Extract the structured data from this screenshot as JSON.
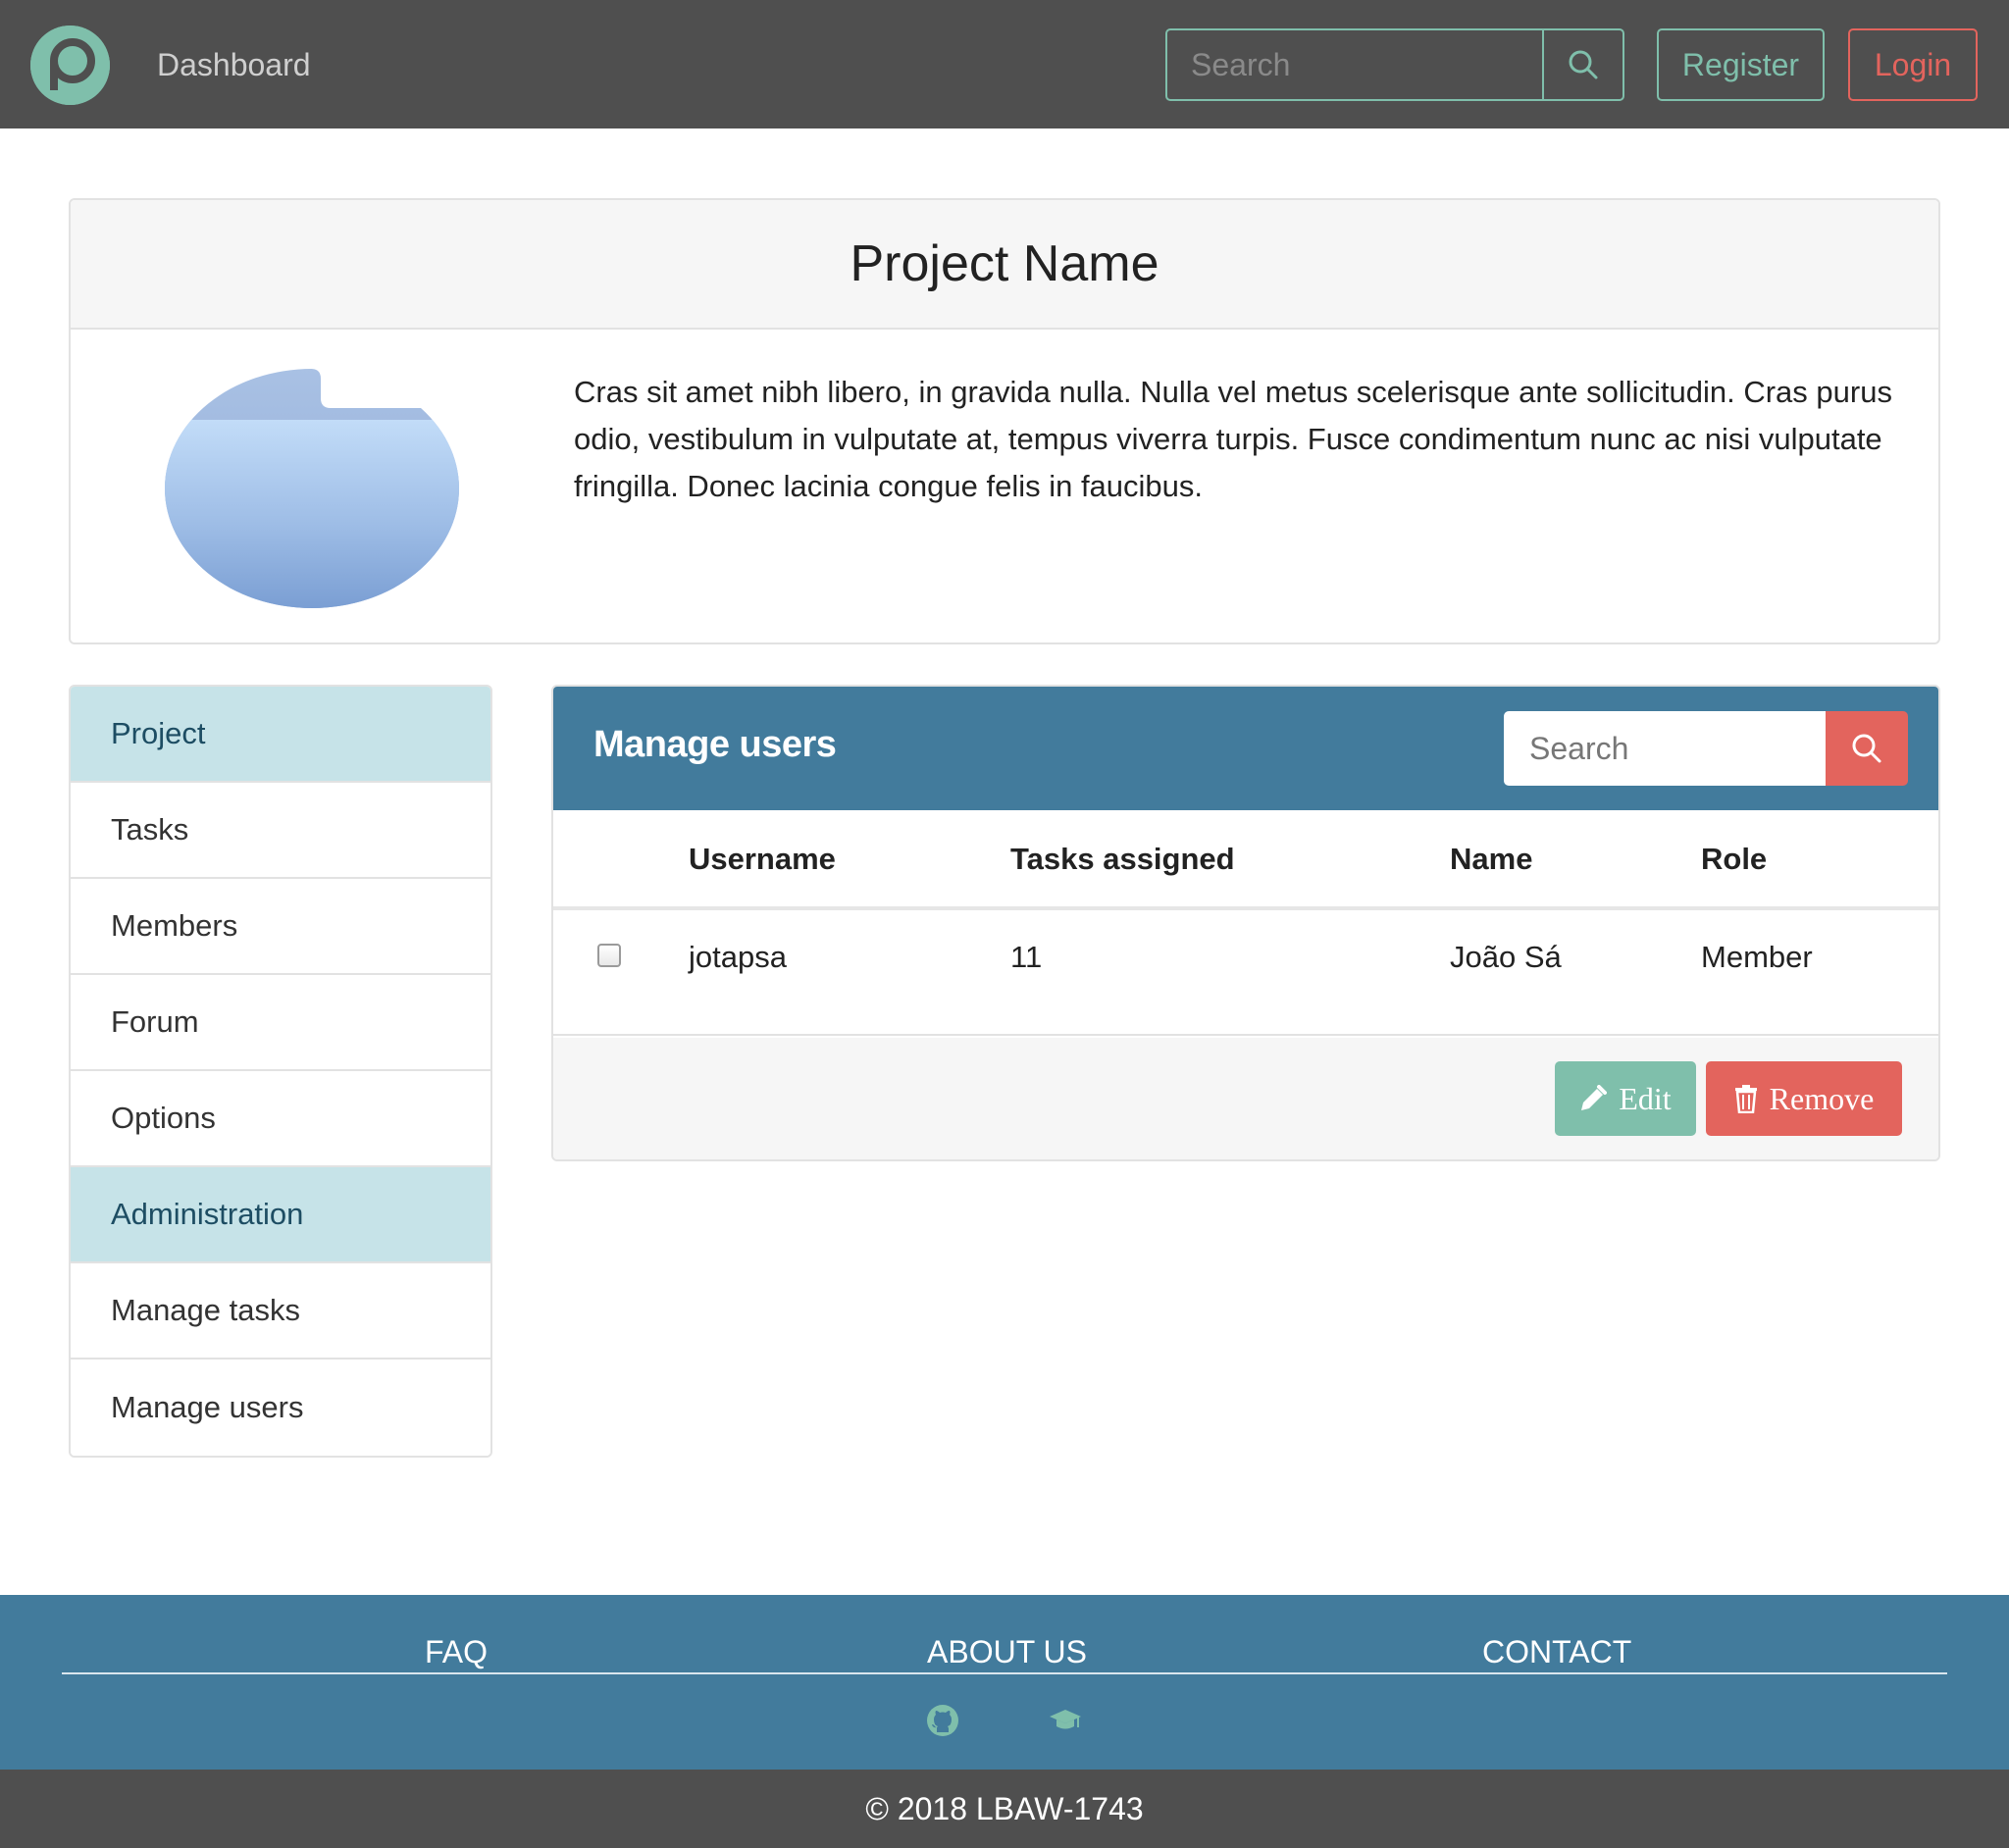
{
  "navbar": {
    "logo_icon": "logo-icon",
    "dashboard_label": "Dashboard",
    "search_placeholder": "Search",
    "search_icon": "search-icon",
    "register_label": "Register",
    "login_label": "Login",
    "accent_color": "#7fbfab",
    "login_color": "#e3645d",
    "background_color": "#4f4f4f"
  },
  "project": {
    "title": "Project Name",
    "image_icon": "folder-icon",
    "description": "Cras sit amet nibh libero, in gravida nulla. Nulla vel metus scelerisque ante sollicitudin. Cras purus odio, vestibulum in vulputate at, tempus viverra turpis. Fusce condimentum nunc ac nisi vulputate fringilla. Donec lacinia congue felis in faucibus."
  },
  "sidebar": {
    "items": [
      {
        "label": "Project",
        "type": "section"
      },
      {
        "label": "Tasks",
        "type": "link"
      },
      {
        "label": "Members",
        "type": "link"
      },
      {
        "label": "Forum",
        "type": "link"
      },
      {
        "label": "Options",
        "type": "link"
      },
      {
        "label": "Administration",
        "type": "section"
      },
      {
        "label": "Manage tasks",
        "type": "link"
      },
      {
        "label": "Manage users",
        "type": "link"
      }
    ],
    "section_color": "#c6e3e8"
  },
  "manage_users": {
    "title": "Manage users",
    "search_placeholder": "Search",
    "search_icon": "search-icon",
    "header_color": "#427b9c",
    "columns": [
      "Username",
      "Tasks assigned",
      "Name",
      "Role"
    ],
    "rows": [
      {
        "checked": false,
        "username": "jotapsa",
        "tasks_assigned": "11",
        "name": "João Sá",
        "role": "Member"
      }
    ],
    "edit_label": "Edit",
    "edit_icon": "pencil-icon",
    "remove_label": "Remove",
    "remove_icon": "trash-icon"
  },
  "footer": {
    "links": [
      "FAQ",
      "ABOUT US",
      "CONTACT"
    ],
    "icons": [
      "github-icon",
      "graduation-cap-icon"
    ],
    "icon_color": "#7fbfab",
    "background_color": "#427b9c",
    "copyright": "© 2018 LBAW-1743"
  }
}
